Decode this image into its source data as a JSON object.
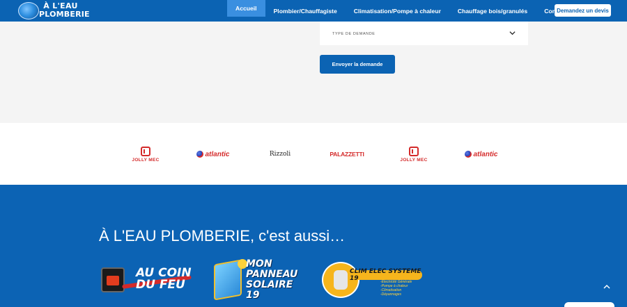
{
  "colors": {
    "brand_blue": "#0b63b3",
    "active_tab": "#3a8fe0",
    "brand_red": "#d42a2a",
    "accent_yellow": "#f6b51c"
  },
  "header": {
    "logo": {
      "line1": "À L'EAU",
      "line2": "PLOMBERIE"
    },
    "nav": [
      {
        "label": "Accueil",
        "active": true
      },
      {
        "label": "Plombier/Chauffagiste",
        "active": false
      },
      {
        "label": "Climatisation/Pompe à chaleur",
        "active": false
      },
      {
        "label": "Chauffage bois/granulés",
        "active": false
      },
      {
        "label": "Contact",
        "active": false
      }
    ],
    "quote_button": "Demandez un devis"
  },
  "form": {
    "select_label": "TYPE DE DEMANDE",
    "select_icon": "chevron-down-icon",
    "submit_label": "Envoyer la demande"
  },
  "brands": [
    {
      "name": "JOLLY MEC"
    },
    {
      "name": "atlantic"
    },
    {
      "name": "Rizzoli"
    },
    {
      "name": "PALAZZETTI"
    },
    {
      "name": "JOLLY MEC"
    },
    {
      "name": "atlantic"
    }
  ],
  "section": {
    "title": "À L'EAU PLOMBERIE, c'est aussi…",
    "partners": {
      "acdf": {
        "line1": "AU COIN",
        "line2": "DU FEU"
      },
      "mps": {
        "line1": "MON",
        "line2": "PANNEAU",
        "line3": "SOLAIRE 19"
      },
      "ces": {
        "title": "CLIM ELEC SYSTEME 19",
        "items": [
          "-Électricité Générale",
          "-Pompe à chaleur",
          "-Climatisation",
          "-Dépannages"
        ]
      }
    }
  }
}
